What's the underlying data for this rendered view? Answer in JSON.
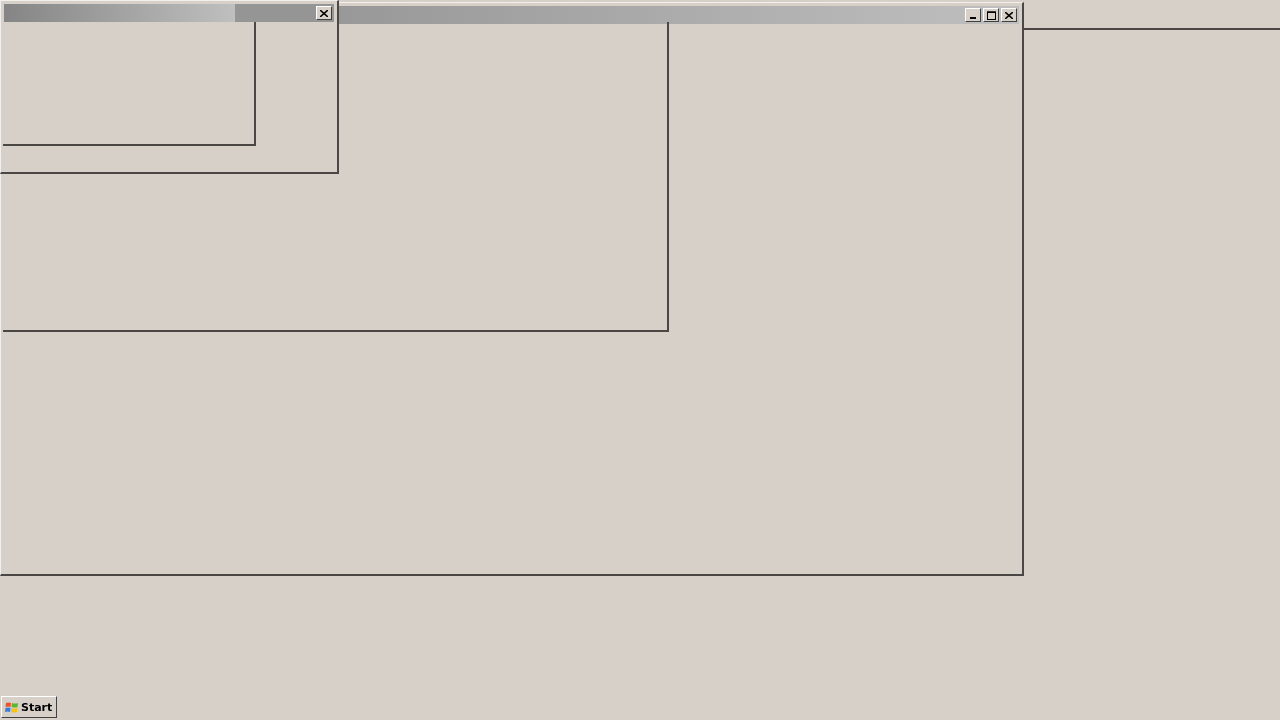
{
  "taskbar": {
    "start_button": {
      "label": "Start"
    }
  }
}
